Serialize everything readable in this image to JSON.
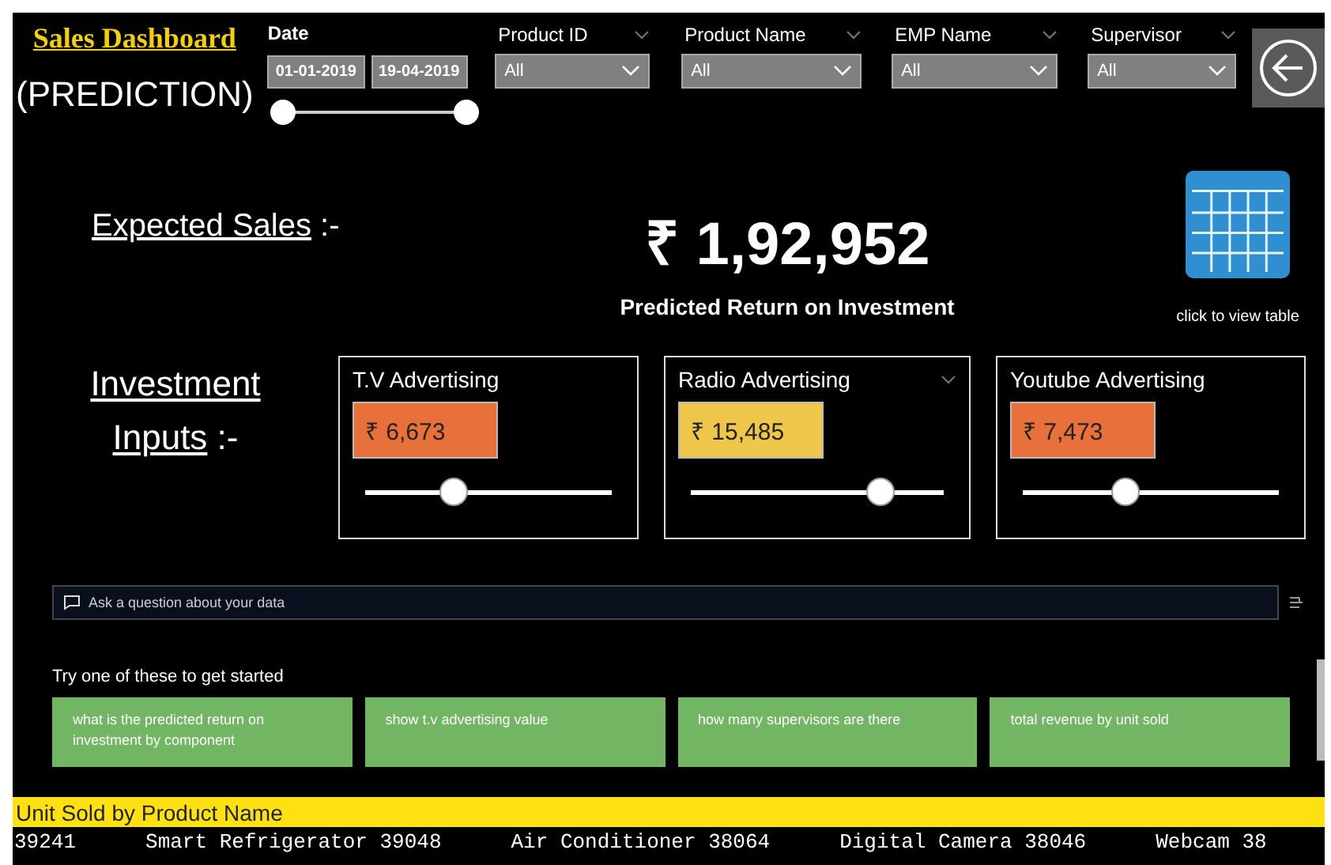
{
  "header": {
    "title": "Sales Dashboard",
    "subtitle": "(PREDICTION)"
  },
  "date_filter": {
    "label": "Date",
    "start": "01-01-2019",
    "end": "19-04-2019",
    "thumbs": [
      {
        "level": 0
      },
      {
        "level": 1
      }
    ]
  },
  "filters": [
    {
      "label": "Product ID",
      "value": "All"
    },
    {
      "label": "Product Name",
      "value": "All"
    },
    {
      "label": "EMP Name",
      "value": "All"
    },
    {
      "label": "Supervisor",
      "value": "All"
    }
  ],
  "kpi": {
    "label": "Expected Sales",
    "suffix": ":-",
    "value": "₹ 1,92,952",
    "caption": "Predicted Return on Investment"
  },
  "table_link": {
    "text": "click to view table"
  },
  "investment": {
    "lines": [
      "Investment",
      "Inputs"
    ],
    "suffix": ":-"
  },
  "cards": [
    {
      "title": "T.V Advertising",
      "value": "₹ 6,673",
      "color": "#e8703a",
      "level": 0.34,
      "menu": false
    },
    {
      "title": "Radio Advertising",
      "value": "₹ 15,485",
      "color": "#eec64a",
      "level": 0.78,
      "menu": true
    },
    {
      "title": "Youtube Advertising",
      "value": "₹ 7,473",
      "color": "#e8703a",
      "level": 0.39,
      "menu": false
    }
  ],
  "qna": {
    "placeholder": "Ask a question about your data",
    "prompt": "Try one of these to get started",
    "suggestions": [
      "what is the predicted return on investment by component",
      "show t.v advertising value",
      "how many supervisors are there",
      "total revenue by unit sold"
    ]
  },
  "ticker": {
    "title": "Unit Sold by Product Name",
    "items": [
      "39241",
      "Smart Refrigerator 39048",
      "Air Conditioner 38064",
      "Digital Camera 38046",
      "Webcam 38"
    ]
  }
}
